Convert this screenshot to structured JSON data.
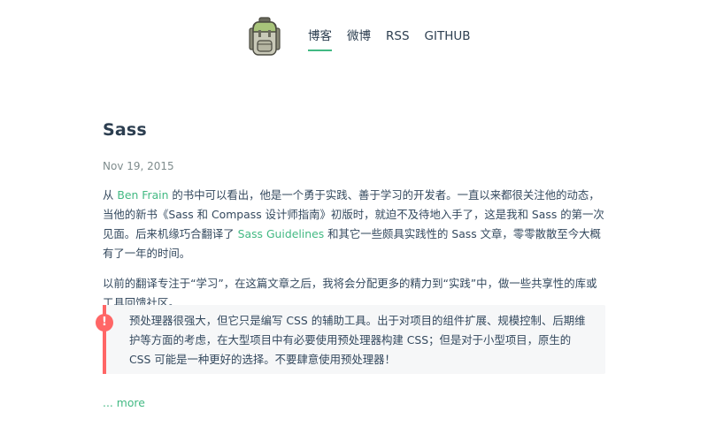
{
  "nav": {
    "items": [
      {
        "label": "博客",
        "active": true
      },
      {
        "label": "微博",
        "active": false
      },
      {
        "label": "RSS",
        "active": false
      },
      {
        "label": "GITHUB",
        "active": false
      }
    ]
  },
  "logo": {
    "icon": "backpack-icon"
  },
  "post": {
    "title": "Sass",
    "date": "Nov 19, 2015",
    "p1": {
      "t1": "从 ",
      "link1": "Ben Frain",
      "t2": " 的书中可以看出，他是一个勇于实践、善于学习的开发者。一直以来都很关注他的动态，当他的新书《Sass 和 Compass 设计师指南》初版时，就迫不及待地入手了，这是我和 Sass 的第一次见面。后来机缘巧合翻译了 ",
      "link2": "Sass Guidelines",
      "t3": " 和其它一些颇具实践性的 Sass 文章，零零散散至今大概有了一年的时间。"
    },
    "p2": "以前的翻译专注于“学习”，在这篇文章之后，我将会分配更多的精力到“实践”中，做一些共享性的库或工具回馈社区。",
    "tip": {
      "icon": "!",
      "text": "预处理器很强大，但它只是编写 CSS 的辅助工具。出于对项目的组件扩展、规模控制、后期维护等方面的考虑，在大型项目中有必要使用预处理器构建 CSS；但是对于小型项目，原生的 CSS 可能是一种更好的选择。不要肆意使用预处理器！"
    },
    "more": "... more"
  },
  "colors": {
    "accent": "#42b983",
    "tip_border": "#ff6666",
    "tip_bg": "#f6f7f8",
    "text": "#34495e"
  }
}
